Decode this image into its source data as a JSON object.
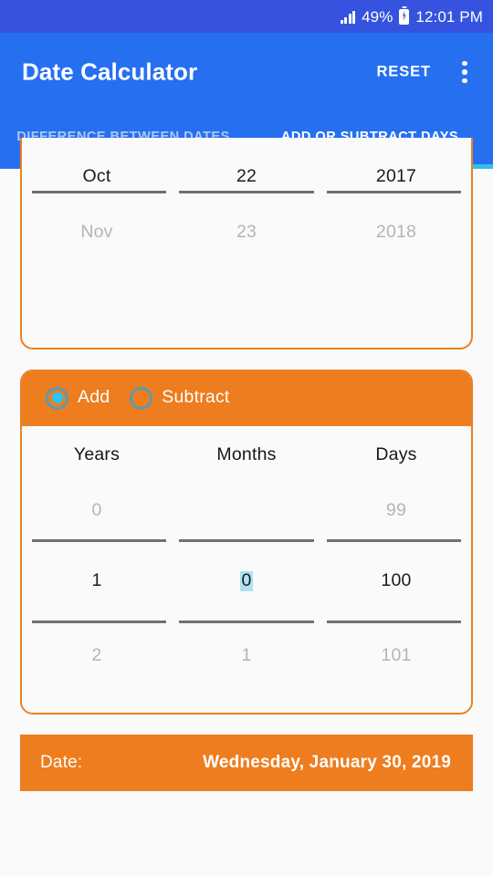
{
  "status_bar": {
    "signal_icon": "signal-bars-icon",
    "battery_percent": "49%",
    "battery_icon": "battery-charging-icon",
    "time": "12:01 PM"
  },
  "app_bar": {
    "title": "Date Calculator",
    "reset_label": "RESET",
    "overflow_icon": "overflow-menu-icon",
    "tabs": [
      {
        "label": "DIFFERENCE BETWEEN DATES",
        "active": false
      },
      {
        "label": "ADD OR SUBTRACT DAYS",
        "active": true
      }
    ]
  },
  "date_picker": {
    "month": {
      "selected": "Oct",
      "next": "Nov"
    },
    "day": {
      "selected": "22",
      "next": "23"
    },
    "year": {
      "selected": "2017",
      "next": "2018"
    }
  },
  "operation": {
    "add_label": "Add",
    "subtract_label": "Subtract",
    "selected": "Add",
    "columns": [
      {
        "header": "Years",
        "previous": "0",
        "selected": "1",
        "next": "2",
        "highlighted": false
      },
      {
        "header": "Months",
        "previous": "",
        "selected": "0",
        "next": "1",
        "highlighted": true
      },
      {
        "header": "Days",
        "previous": "99",
        "selected": "100",
        "next": "101",
        "highlighted": false
      }
    ]
  },
  "result": {
    "label": "Date:",
    "value": "Wednesday, January 30, 2019"
  },
  "colors": {
    "status_bar": "#3553DE",
    "app_bar": "#2670F0",
    "tab_indicator": "#35BDEA",
    "accent_orange": "#ED7D1F",
    "card_border": "#E8821F",
    "radio_ring": "#5B9BB0",
    "radio_dot": "#29C5F6",
    "selection_highlight": "#ADE2F2",
    "background": "#FAFAFA",
    "inactive_tab_text": "#AFC6F6",
    "ghost_text": "#B4B4B4"
  }
}
